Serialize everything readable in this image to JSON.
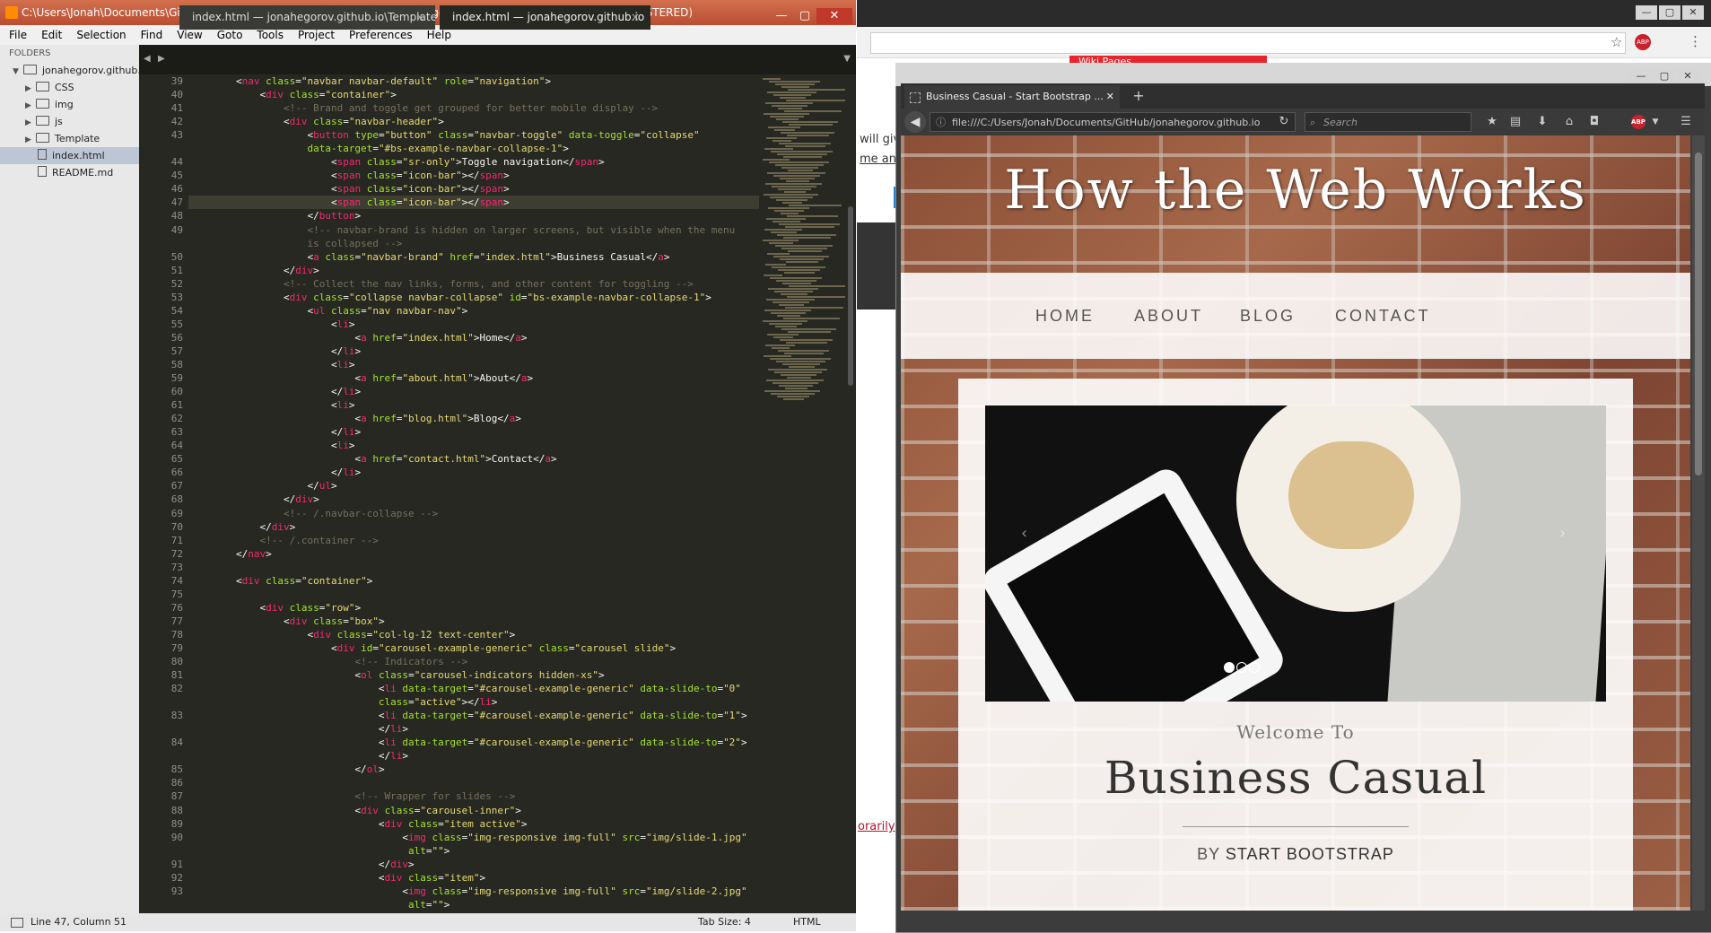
{
  "background_browser": {
    "wiki_pages_label": "Wiki Pages",
    "text_fragment_1": "will giv",
    "text_fragment_2": "me anc",
    "text_fragment_3": "orarily",
    "abp_label": "ABP"
  },
  "sublime": {
    "title": "C:\\Users\\Jonah\\Documents\\GitHub\\jonahegorov.github.io\\index.html (jonahegorov.github.io) - Sublime Text (UNREGISTERED)",
    "menu": [
      "File",
      "Edit",
      "Selection",
      "Find",
      "View",
      "Goto",
      "Tools",
      "Project",
      "Preferences",
      "Help"
    ],
    "sidebar": {
      "header": "FOLDERS",
      "root": "jonahegorov.github.io",
      "items": [
        {
          "label": "CSS",
          "type": "folder"
        },
        {
          "label": "img",
          "type": "folder"
        },
        {
          "label": "js",
          "type": "folder"
        },
        {
          "label": "Template",
          "type": "folder"
        },
        {
          "label": "index.html",
          "type": "file",
          "selected": true
        },
        {
          "label": "README.md",
          "type": "file"
        }
      ]
    },
    "tabs": [
      {
        "label": "index.html — jonahegorov.github.io\\Template",
        "active": false
      },
      {
        "label": "index.html — jonahegorov.github.io",
        "active": true
      }
    ],
    "status": {
      "position": "Line 47, Column 51",
      "tab_size": "Tab Size: 4",
      "syntax": "HTML"
    },
    "code_lines": [
      {
        "n": "39",
        "t": "        <nav class=\"navbar navbar-default\" role=\"navigation\">"
      },
      {
        "n": "40",
        "t": "            <div class=\"container\">"
      },
      {
        "n": "41",
        "t": "                <!-- Brand and toggle get grouped for better mobile display -->",
        "c": true
      },
      {
        "n": "42",
        "t": "                <div class=\"navbar-header\">"
      },
      {
        "n": "43",
        "t": "                    <button type=\"button\" class=\"navbar-toggle\" data-toggle=\"collapse\""
      },
      {
        "n": "",
        "t": "                    data-target=\"#bs-example-navbar-collapse-1\">"
      },
      {
        "n": "44",
        "t": "                        <span class=\"sr-only\">Toggle navigation</span>"
      },
      {
        "n": "45",
        "t": "                        <span class=\"icon-bar\"></span>"
      },
      {
        "n": "46",
        "t": "                        <span class=\"icon-bar\"></span>"
      },
      {
        "n": "47",
        "t": "                        <span class=\"icon-bar\"></span>",
        "hl": true
      },
      {
        "n": "48",
        "t": "                    </button>"
      },
      {
        "n": "49",
        "t": "                    <!-- navbar-brand is hidden on larger screens, but visible when the menu",
        "c": true
      },
      {
        "n": "",
        "t": "                    is collapsed -->",
        "c": true
      },
      {
        "n": "50",
        "t": "                    <a class=\"navbar-brand\" href=\"index.html\">Business Casual</a>"
      },
      {
        "n": "51",
        "t": "                </div>"
      },
      {
        "n": "52",
        "t": "                <!-- Collect the nav links, forms, and other content for toggling -->",
        "c": true
      },
      {
        "n": "53",
        "t": "                <div class=\"collapse navbar-collapse\" id=\"bs-example-navbar-collapse-1\">"
      },
      {
        "n": "54",
        "t": "                    <ul class=\"nav navbar-nav\">"
      },
      {
        "n": "55",
        "t": "                        <li>"
      },
      {
        "n": "56",
        "t": "                            <a href=\"index.html\">Home</a>"
      },
      {
        "n": "57",
        "t": "                        </li>"
      },
      {
        "n": "58",
        "t": "                        <li>"
      },
      {
        "n": "59",
        "t": "                            <a href=\"about.html\">About</a>"
      },
      {
        "n": "60",
        "t": "                        </li>"
      },
      {
        "n": "61",
        "t": "                        <li>"
      },
      {
        "n": "62",
        "t": "                            <a href=\"blog.html\">Blog</a>"
      },
      {
        "n": "63",
        "t": "                        </li>"
      },
      {
        "n": "64",
        "t": "                        <li>"
      },
      {
        "n": "65",
        "t": "                            <a href=\"contact.html\">Contact</a>"
      },
      {
        "n": "66",
        "t": "                        </li>"
      },
      {
        "n": "67",
        "t": "                    </ul>"
      },
      {
        "n": "68",
        "t": "                </div>"
      },
      {
        "n": "69",
        "t": "                <!-- /.navbar-collapse -->",
        "c": true
      },
      {
        "n": "70",
        "t": "            </div>"
      },
      {
        "n": "71",
        "t": "            <!-- /.container -->",
        "c": true
      },
      {
        "n": "72",
        "t": "        </nav>"
      },
      {
        "n": "73",
        "t": ""
      },
      {
        "n": "74",
        "t": "        <div class=\"container\">"
      },
      {
        "n": "75",
        "t": ""
      },
      {
        "n": "76",
        "t": "            <div class=\"row\">"
      },
      {
        "n": "77",
        "t": "                <div class=\"box\">"
      },
      {
        "n": "78",
        "t": "                    <div class=\"col-lg-12 text-center\">"
      },
      {
        "n": "79",
        "t": "                        <div id=\"carousel-example-generic\" class=\"carousel slide\">"
      },
      {
        "n": "80",
        "t": "                            <!-- Indicators -->",
        "c": true
      },
      {
        "n": "81",
        "t": "                            <ol class=\"carousel-indicators hidden-xs\">"
      },
      {
        "n": "82",
        "t": "                                <li data-target=\"#carousel-example-generic\" data-slide-to=\"0\""
      },
      {
        "n": "",
        "t": "                                class=\"active\"></li>"
      },
      {
        "n": "83",
        "t": "                                <li data-target=\"#carousel-example-generic\" data-slide-to=\"1\">"
      },
      {
        "n": "",
        "t": "                                </li>"
      },
      {
        "n": "84",
        "t": "                                <li data-target=\"#carousel-example-generic\" data-slide-to=\"2\">"
      },
      {
        "n": "",
        "t": "                                </li>"
      },
      {
        "n": "85",
        "t": "                            </ol>"
      },
      {
        "n": "86",
        "t": ""
      },
      {
        "n": "87",
        "t": "                            <!-- Wrapper for slides -->",
        "c": true
      },
      {
        "n": "88",
        "t": "                            <div class=\"carousel-inner\">"
      },
      {
        "n": "89",
        "t": "                                <div class=\"item active\">"
      },
      {
        "n": "90",
        "t": "                                    <img class=\"img-responsive img-full\" src=\"img/slide-1.jpg\""
      },
      {
        "n": "",
        "t": "                                     alt=\"\">"
      },
      {
        "n": "91",
        "t": "                                </div>"
      },
      {
        "n": "92",
        "t": "                                <div class=\"item\">"
      },
      {
        "n": "93",
        "t": "                                    <img class=\"img-responsive img-full\" src=\"img/slide-2.jpg\""
      },
      {
        "n": "",
        "t": "                                     alt=\"\">"
      }
    ]
  },
  "firefox": {
    "tab_title": "Business Casual - Start Bootstrap ...",
    "url": "file:///C:/Users/Jonah/Documents/GitHub/jonahegorov.github.io",
    "search_placeholder": "Search",
    "page": {
      "site_title": "How the Web Works",
      "nav": [
        "HOME",
        "ABOUT",
        "BLOG",
        "CONTACT"
      ],
      "welcome": "Welcome To",
      "heading": "Business Casual",
      "byline_prefix": "BY",
      "byline_name": "START BOOTSTRAP",
      "carousel_slides": 3,
      "carousel_active": 1
    }
  },
  "colors": {
    "sublime_bg": "#272822",
    "sublime_title": "#c8573b",
    "tag": "#f92672",
    "attr": "#a6e22e",
    "string": "#e6db74",
    "comment": "#75715e"
  }
}
